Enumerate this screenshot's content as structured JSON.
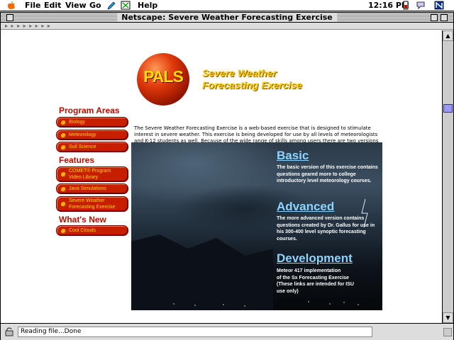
{
  "menubar": {
    "items": [
      "File",
      "Edit",
      "View",
      "Go",
      "Help"
    ],
    "clock": "12:16 PM"
  },
  "window": {
    "title": "Netscape: Severe Weather Forecasting Exercise",
    "status": "Reading file...Done"
  },
  "header": {
    "logo_text": "PALS",
    "title_line1": "Severe Weather",
    "title_line2": "Forecasting Exercise"
  },
  "sidebar": {
    "headings": [
      "Program Areas",
      "Features",
      "What's New"
    ],
    "program_areas": [
      "Biology",
      "Meteorology",
      "Soil Science"
    ],
    "features": [
      [
        "COMET® Program",
        "Video Library"
      ],
      [
        "Java Simulations"
      ],
      [
        "Severe Weather",
        "Forecasting Exercise"
      ]
    ],
    "whats_new": [
      "Cool Clouds"
    ]
  },
  "intro": "The Severe Weather Forecasting Exercise is a web-based exercise that is designed to stimulate interest in severe weather. This exercise is being developed for use by all levels of meteorologists and K-12 students as well. Because of the wide range of skills among users there are two versions of the forecasting exercise. Watch this page for updated cases and renovations.",
  "sections": [
    {
      "title": "Basic",
      "desc": "The basic version of this exercise contains questions geared more to college introductory level meteorology courses."
    },
    {
      "title": "Advanced",
      "desc": "The more advanced version contains questions created by Dr. Gallus for use in his 300-400 level synoptic forecasting courses."
    },
    {
      "title": "Development",
      "desc_lines": [
        "Meteor 417 implementation",
        "of the Sx Forecasting Exercise",
        "(These links are intended for ISU",
        "use only)"
      ]
    }
  ],
  "colors": {
    "accent_red": "#c81e00",
    "title_gold": "#ffcc00",
    "link_blue": "#8cd4ff"
  }
}
